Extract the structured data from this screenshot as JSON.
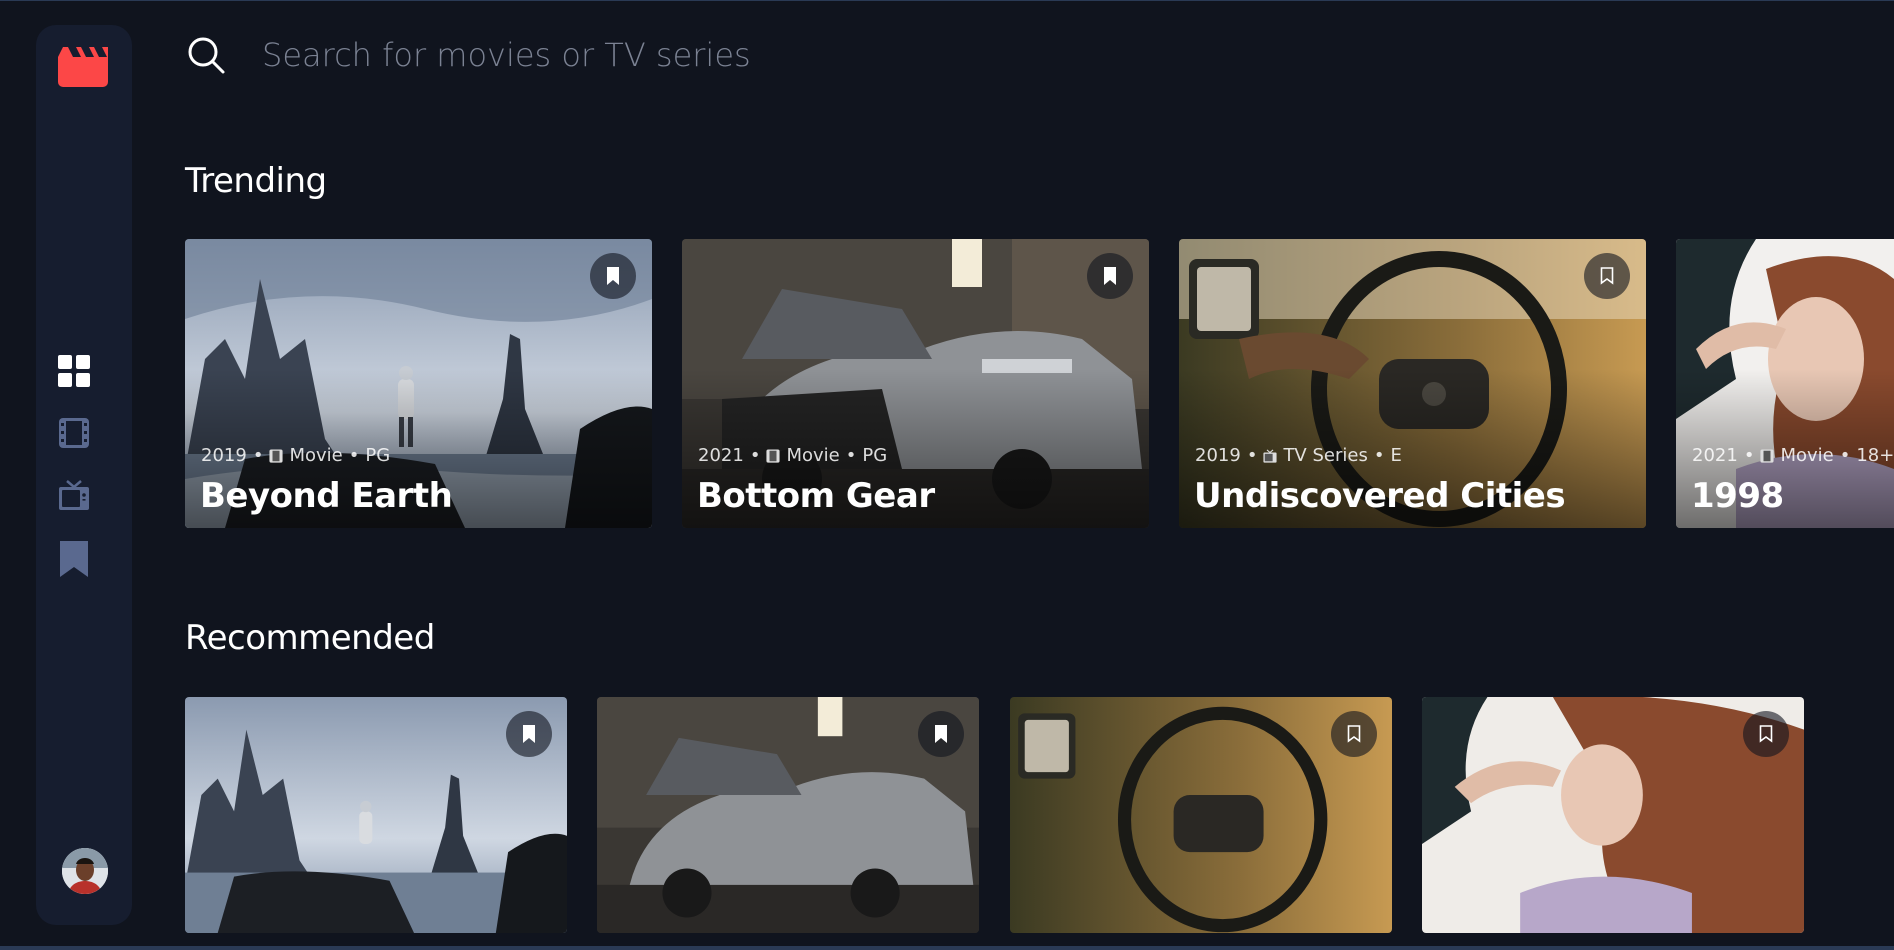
{
  "app": {
    "name": "Entertainment"
  },
  "search": {
    "placeholder": "Search for movies or TV series"
  },
  "nav": [
    {
      "id": "home",
      "icon": "grid-icon",
      "active": true
    },
    {
      "id": "movies",
      "icon": "film-icon",
      "active": false
    },
    {
      "id": "tv",
      "icon": "tv-icon",
      "active": false
    },
    {
      "id": "bookmarks",
      "icon": "bookmark-icon",
      "active": false
    }
  ],
  "trending": {
    "title": "Trending",
    "items": [
      {
        "year": "2019",
        "category": "Movie",
        "rating": "PG",
        "title": "Beyond Earth",
        "category_icon": "film-icon",
        "bookmarked": true
      },
      {
        "year": "2021",
        "category": "Movie",
        "rating": "PG",
        "title": "Bottom Gear",
        "category_icon": "film-icon",
        "bookmarked": true
      },
      {
        "year": "2019",
        "category": "TV Series",
        "rating": "E",
        "title": "Undiscovered Cities",
        "category_icon": "tv-icon",
        "bookmarked": false
      },
      {
        "year": "2021",
        "category": "Movie",
        "rating": "18+",
        "title": "1998",
        "category_icon": "film-icon",
        "bookmarked": false
      }
    ]
  },
  "recommended": {
    "title": "Recommended",
    "items": [
      {
        "bookmarked": true
      },
      {
        "bookmarked": true
      },
      {
        "bookmarked": false
      },
      {
        "bookmarked": false
      }
    ]
  },
  "colors": {
    "background": "#10141E",
    "sidebar": "#161D2F",
    "accent": "#FC4747",
    "nav_icon": "#5A698F",
    "nav_active": "#FFFFFF"
  }
}
